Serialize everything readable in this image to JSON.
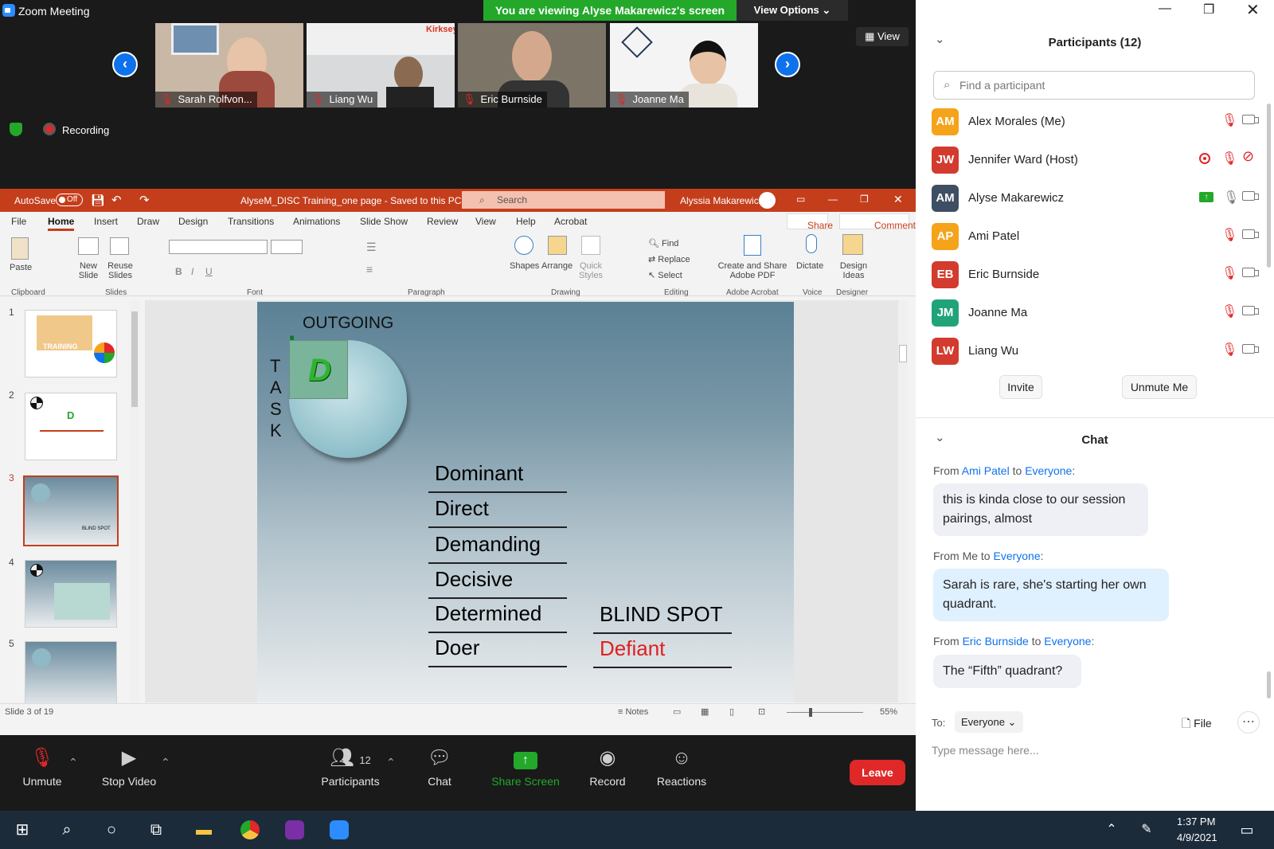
{
  "window": {
    "title": "Zoom Meeting"
  },
  "banner": {
    "viewing": "You are viewing Alyse Makarewicz's screen",
    "view_options": "View Options"
  },
  "view_button": "View",
  "gallery": [
    {
      "name": "Sarah Rolfvon...",
      "bg": "#c9b8a6"
    },
    {
      "name": "Liang Wu",
      "bg": "#d9dadb"
    },
    {
      "name": "Eric Burnside",
      "bg": "#7c7466"
    },
    {
      "name": "Joanne Ma",
      "bg": "#f4f4f4"
    }
  ],
  "recording": "Recording",
  "ppt": {
    "autosave": "AutoSave",
    "autosave_state": "Off",
    "doc_title": "AlyseM_DISC Training_one page  -  Saved to this PC",
    "search": "Search",
    "user": "Alyssia Makarewicz",
    "tabs": [
      "File",
      "Home",
      "Insert",
      "Draw",
      "Design",
      "Transitions",
      "Animations",
      "Slide Show",
      "Review",
      "View",
      "Help",
      "Acrobat"
    ],
    "share": "Share",
    "comments": "Comments",
    "ribbon": {
      "paste": "Paste",
      "new_slide": "New Slide",
      "reuse_slides": "Reuse Slides",
      "shapes": "Shapes",
      "arrange": "Arrange",
      "quick_styles": "Quick Styles",
      "find": "Find",
      "replace": "Replace",
      "select": "Select",
      "create_share": "Create and Share Adobe PDF",
      "dictate": "Dictate",
      "design_ideas": "Design Ideas",
      "groups": [
        "Clipboard",
        "Slides",
        "Font",
        "Paragraph",
        "Drawing",
        "Editing",
        "Adobe Acrobat",
        "Voice",
        "Designer"
      ]
    },
    "slide_numbers": [
      "1",
      "2",
      "3",
      "4",
      "5"
    ],
    "thumb_texts": {
      "s1": "TRAINING",
      "s2": "D",
      "s3": "BLIND SPOT"
    },
    "status": {
      "slide_of": "Slide 3 of 19",
      "notes": "Notes",
      "zoom": "55%"
    },
    "slide": {
      "outgoing": "OUTGOING",
      "task": [
        "T",
        "A",
        "S",
        "K"
      ],
      "letter": "D",
      "words": [
        "Dominant",
        "Direct",
        "Demanding",
        "Decisive",
        "Determined",
        "Doer"
      ],
      "blind_spot": "BLIND SPOT",
      "defiant": "Defiant"
    }
  },
  "toolbar": {
    "unmute": "Unmute",
    "stop_video": "Stop Video",
    "participants": "Participants",
    "participants_count": "12",
    "chat": "Chat",
    "share_screen": "Share Screen",
    "record": "Record",
    "reactions": "Reactions",
    "leave": "Leave"
  },
  "participants_panel": {
    "title": "Participants (12)",
    "search_placeholder": "Find a participant",
    "people": [
      {
        "initials": "AM",
        "name": "Alex Morales (Me)",
        "color": "#f5a31a"
      },
      {
        "initials": "JW",
        "name": "Jennifer Ward (Host)",
        "color": "#d23b2e"
      },
      {
        "initials": "AM",
        "name": "Alyse Makarewicz",
        "color": "#3e4e63"
      },
      {
        "initials": "AP",
        "name": "Ami Patel",
        "color": "#f5a31a"
      },
      {
        "initials": "EB",
        "name": "Eric Burnside",
        "color": "#d23b2e"
      },
      {
        "initials": "JM",
        "name": "Joanne Ma",
        "color": "#21a37a"
      },
      {
        "initials": "LW",
        "name": "Liang Wu",
        "color": "#d23b2e"
      }
    ],
    "invite": "Invite",
    "unmute_me": "Unmute Me"
  },
  "chat": {
    "title": "Chat",
    "messages": [
      {
        "from": "Ami Patel",
        "to": "Everyone",
        "text": "this is kinda close to our session pairings, almost"
      },
      {
        "from": "Me",
        "to": "Everyone",
        "text": "Sarah is rare, she's starting her own quadrant."
      },
      {
        "from": "Eric Burnside",
        "to": "Everyone",
        "text": "The “Fifth” quadrant?"
      }
    ],
    "from_word": "From",
    "to_word": "to",
    "to_label": "To:",
    "to_value": "Everyone",
    "file": "File",
    "placeholder": "Type message here..."
  },
  "taskbar": {
    "time": "1:37 PM",
    "date": "4/9/2021"
  }
}
